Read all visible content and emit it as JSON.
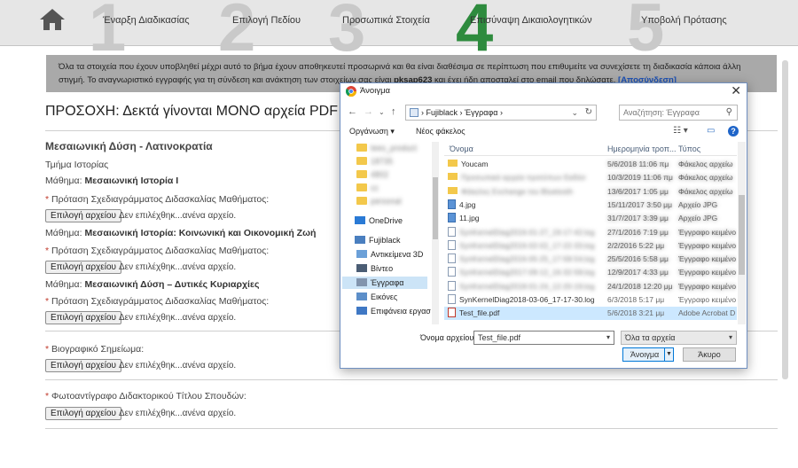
{
  "steps": [
    {
      "num": "1",
      "label": "Έναρξη Διαδικασίας",
      "active": false
    },
    {
      "num": "2",
      "label": "Επιλογή Πεδίου",
      "active": false
    },
    {
      "num": "3",
      "label": "Προσωπικά Στοιχεία",
      "active": false
    },
    {
      "num": "4",
      "label": "Επισύναψη Δικαιολογητικών",
      "active": true
    },
    {
      "num": "5",
      "label": "Υποβολή Πρότασης",
      "active": false
    }
  ],
  "info": {
    "line1": "Όλα τα στοιχεία που έχουν υποβληθεί μέχρι αυτό το βήμα έχουν αποθηκευτεί προσωρινά και θα είναι διαθέσιμα σε περίπτωση που επιθυμείτε να συνεχίσετε τη διαδικασία κάποια άλλη",
    "line2_pre": "στιγμή. Το αναγνωριστικό εγγραφής για τη σύνδεση και ανάκτηση των στοιχείων σας είναι",
    "code": "pksap623",
    "line2_post": "και έχει ήδη αποσταλεί στο email που δηλώσατε.",
    "link": "[Αποσύνδεση]"
  },
  "warning": "ΠΡΟΣΟΧΗ: Δεκτά γίνονται ΜΟΝΟ αρχεία PDF βάρο",
  "section": {
    "title": "Μεσαιωνική Δύση - Λατινοκρατία",
    "department": "Τμήμα Ιστορίας",
    "course_prefix": "Μάθημα:",
    "courses": [
      "Μεσαιωνική Ιστορία Ι",
      "Μεσαιωνική Ιστορία: Κοινωνική και Οικονομική Ζωή",
      "Μεσαιωνική Δύση – Δυτικές Κυριαρχίες"
    ],
    "proposal_label": "Πρόταση Σχεδιαγράμματος Διδασκαλίας Μαθήματος:"
  },
  "cv_label": "Βιογραφικό Σημείωμα:",
  "phd_label": "Φωτοαντίγραφο Διδακτορικού Τίτλου Σπουδών:",
  "file_button": "Επιλογή αρχείου",
  "no_file": "Δεν επιλέχθηκ...ανένα αρχείο.",
  "dialog": {
    "title": "Άνοιγμα",
    "path": [
      "Fujiblack",
      "Έγγραφα"
    ],
    "search_placeholder": "Αναζήτηση: Έγγραφα",
    "organize": "Οργάνωση ▾",
    "new_folder": "Νέος φάκελος",
    "nav": [
      {
        "label": "tees_product",
        "icon": "folder",
        "blurred": true
      },
      {
        "label": "18735",
        "icon": "folder",
        "blurred": true
      },
      {
        "label": "4802",
        "icon": "folder",
        "blurred": true
      },
      {
        "label": "cc",
        "icon": "folder",
        "blurred": true
      },
      {
        "label": "personal",
        "icon": "folder",
        "blurred": true
      },
      {
        "label": "OneDrive",
        "icon": "onedrive",
        "blurred": false
      },
      {
        "label": "Fujiblack",
        "icon": "pc",
        "blurred": false
      },
      {
        "label": "Αντικείμενα 3D",
        "icon": "3d",
        "blurred": false
      },
      {
        "label": "Βίντεο",
        "icon": "video",
        "blurred": false
      },
      {
        "label": "Έγγραφα",
        "icon": "docs",
        "blurred": false,
        "selected": true
      },
      {
        "label": "Εικόνες",
        "icon": "pictures",
        "blurred": false
      },
      {
        "label": "Επιφάνεια εργασ",
        "icon": "desktop",
        "blurred": false
      }
    ],
    "columns": [
      "Όνομα",
      "Ημερομηνία τροπ...",
      "Τύπος"
    ],
    "files": [
      {
        "name": "Youcam",
        "date": "5/6/2018 11:06 πμ",
        "type": "Φάκελος αρχείω",
        "icon": "fold",
        "blur_name": false,
        "blur_meta": true
      },
      {
        "name": "Προσωπικά αρχεία προτύπων Εκδόσ",
        "date": "10/3/2019 11:06 πμ",
        "type": "Φάκελος αρχείω",
        "icon": "fold",
        "blur_name": true,
        "blur_meta": true
      },
      {
        "name": "Φάκελος Exchange του Bluetooth",
        "date": "13/6/2017 1:05 μμ",
        "type": "Φάκελος αρχείω",
        "icon": "fold",
        "blur_name": true,
        "blur_meta": true
      },
      {
        "name": "4.jpg",
        "date": "15/11/2017 3:50 μμ",
        "type": "Αρχείο JPG",
        "icon": "jpg",
        "blur_name": false,
        "blur_meta": true
      },
      {
        "name": "11.jpg",
        "date": "31/7/2017 3:39 μμ",
        "type": "Αρχείο JPG",
        "icon": "jpg",
        "blur_name": false,
        "blur_meta": true
      },
      {
        "name": "SynKernelDiag2016-01-27_19-17-42.log",
        "date": "27/1/2016 7:19 μμ",
        "type": "Έγγραφο κειμένο",
        "icon": "doc",
        "blur_name": true,
        "blur_meta": true
      },
      {
        "name": "SynKernelDiag2016-02-02_17-22-33.log",
        "date": "2/2/2016 5:22 μμ",
        "type": "Έγγραφο κειμένο",
        "icon": "doc",
        "blur_name": true,
        "blur_meta": true
      },
      {
        "name": "SynKernelDiag2016-05-25_17-58-54.log",
        "date": "25/5/2016 5:58 μμ",
        "type": "Έγγραφο κειμένο",
        "icon": "doc",
        "blur_name": true,
        "blur_meta": true
      },
      {
        "name": "SynKernelDiag2017-09-12_16-32-58.log",
        "date": "12/9/2017 4:33 μμ",
        "type": "Έγγραφο κειμένο",
        "icon": "doc",
        "blur_name": true,
        "blur_meta": true
      },
      {
        "name": "SynKernelDiag2018-01-24_12-20-19.log",
        "date": "24/1/2018 12:20 μμ",
        "type": "Έγγραφο κειμένο",
        "icon": "doc",
        "blur_name": true,
        "blur_meta": true
      },
      {
        "name": "SynKernelDiag2018-03-06_17-17-30.log",
        "date": "6/3/2018 5:17 μμ",
        "type": "Έγγραφο κειμένο",
        "icon": "doc",
        "blur_name": false,
        "blur_meta": false
      },
      {
        "name": "Test_file.pdf",
        "date": "5/6/2018 3:21 μμ",
        "type": "Adobe Acrobat D",
        "icon": "pdf",
        "blur_name": false,
        "blur_meta": false,
        "selected": true
      }
    ],
    "filename_label": "Όνομα αρχείου:",
    "filename_value": "Test_file.pdf",
    "filetype_value": "Όλα τα αρχεία",
    "open_label": "Άνοιγμα",
    "cancel_label": "Άκυρο"
  }
}
